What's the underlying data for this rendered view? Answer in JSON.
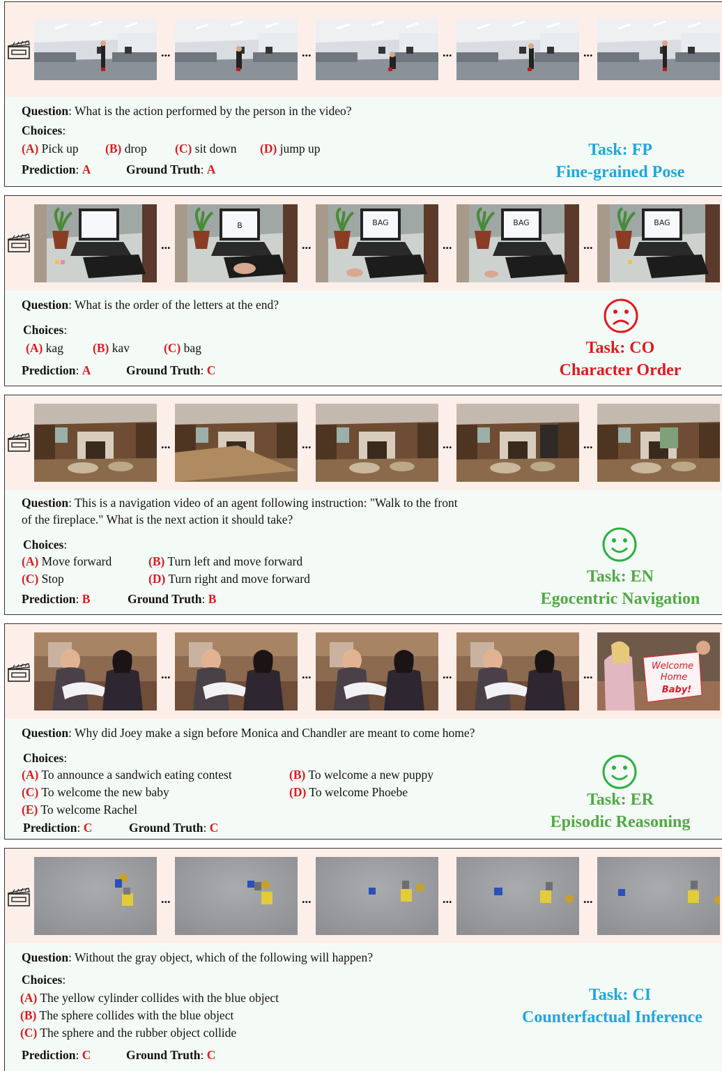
{
  "labels": {
    "question": "Question",
    "choices": "Choices",
    "prediction": "Prediction",
    "ground_truth": "Ground Truth",
    "ellipsis": "..."
  },
  "panels": [
    {
      "question": "What is the action performed by the person in the video?",
      "choices": [
        {
          "key": "(A)",
          "text": "Pick up"
        },
        {
          "key": "(B)",
          "text": "drop"
        },
        {
          "key": "(C)",
          "text": "sit down"
        },
        {
          "key": "(D)",
          "text": "jump up"
        }
      ],
      "prediction": "A",
      "ground_truth": "A",
      "task_code": "Task: FP",
      "task_name": "Fine-grained Pose",
      "task_color": "#1ea7e0",
      "face": "none"
    },
    {
      "question": "What is the order of the letters at the end?",
      "choices": [
        {
          "key": "(A)",
          "text": "kag"
        },
        {
          "key": "(B)",
          "text": "kav"
        },
        {
          "key": "(C)",
          "text": "bag"
        }
      ],
      "screen_texts": [
        "",
        "B",
        "BAG",
        "BAG",
        "BAG"
      ],
      "prediction": "A",
      "ground_truth": "C",
      "task_code": "Task: CO",
      "task_name": "Character Order",
      "task_color": "#e0191f",
      "face": "sad"
    },
    {
      "question_line1": "This is a navigation video of an agent following instruction: \"Walk to the front",
      "question_line2": "of the fireplace.\" What is the next action it should take?",
      "choices": [
        {
          "key": "(A)",
          "text": "Move forward"
        },
        {
          "key": "(B)",
          "text": "Turn left and move forward"
        },
        {
          "key": "(C)",
          "text": "Stop"
        },
        {
          "key": "(D)",
          "text": "Turn right and move forward"
        }
      ],
      "prediction": "B",
      "ground_truth": "B",
      "task_code": "Task: EN",
      "task_name": "Egocentric Navigation",
      "task_color": "#52a845",
      "face": "happy"
    },
    {
      "question": "Why did Joey make a sign before Monica and Chandler are meant to come home?",
      "choices": [
        {
          "key": "(A)",
          "text": "To announce a sandwich eating contest"
        },
        {
          "key": "(B)",
          "text": "To welcome a new puppy"
        },
        {
          "key": "(C)",
          "text": "To welcome the new baby"
        },
        {
          "key": "(D)",
          "text": "To welcome Phoebe"
        },
        {
          "key": "(E)",
          "text": "To welcome Rachel"
        }
      ],
      "sign_text": [
        "Welcome",
        "Home",
        "Baby!"
      ],
      "prediction": "C",
      "ground_truth": "C",
      "task_code": "Task: ER",
      "task_name": "Episodic Reasoning",
      "task_color": "#52a845",
      "face": "happy"
    },
    {
      "question": "Without the gray object, which of the following will happen?",
      "choices": [
        {
          "key": "(A)",
          "text": "The yellow cylinder collides with the blue object"
        },
        {
          "key": "(B)",
          "text": "The sphere collides with the blue object"
        },
        {
          "key": "(C)",
          "text": "The sphere and the rubber object collide"
        }
      ],
      "prediction": "C",
      "ground_truth": "C",
      "task_code": "Task: CI",
      "task_name": "Counterfactual Inference",
      "task_color": "#1ea7e0",
      "face": "none"
    }
  ]
}
